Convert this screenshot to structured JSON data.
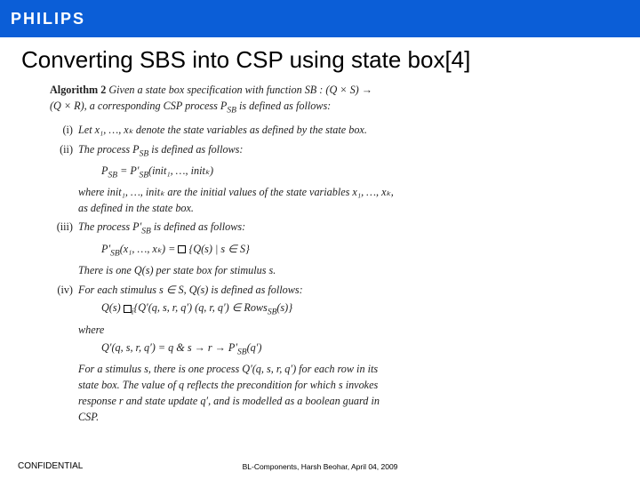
{
  "header": {
    "logo": "PHILIPS"
  },
  "title": "Converting SBS into CSP using state box[4]",
  "algo": {
    "label": "Algorithm 2",
    "intro1": "Given a state box specification with function SB : (Q × S) →",
    "intro2": "(Q × R), a corresponding CSP process P",
    "intro2_sub": "SB",
    "intro2_tail": " is defined as follows:",
    "items": [
      {
        "num": "(i)",
        "body": "Let x₁, …, xₖ denote the state variables as defined by the state box."
      },
      {
        "num": "(ii)",
        "body_a": "The process P",
        "body_a_sub": "SB",
        "body_a_tail": " is defined as follows:",
        "eq_a": "P",
        "eq_a_sub": "SB",
        "eq_a_mid": " = P′",
        "eq_a_sub2": "SB",
        "eq_a_tail": "(init₁, …, initₖ)",
        "body_b": "where init₁, …, initₖ are the initial values of the state variables x₁, …, xₖ,",
        "body_c": "as defined in the state box."
      },
      {
        "num": "(iii)",
        "body_a": "The process P′",
        "body_a_sub": "SB",
        "body_a_tail": " is defined as follows:",
        "eq_left": "P′",
        "eq_left_sub": "SB",
        "eq_left_tail": "(x₁, …, xₖ) = ",
        "eq_right": "{Q(s)  |  s ∈ S}",
        "body_b": "There is one Q(s) per state box for stimulus s."
      },
      {
        "num": "(iv)",
        "body_a": "For each stimulus s ∈ S, Q(s) is defined as follows:",
        "eq_left": "Q(s)  ",
        "eq_mid_sub": "i",
        "eq_mid": "{Q′(q, s, r, q′)     (q, r, q′) ∈ Rows",
        "eq_mid_sub2": "SB",
        "eq_mid_tail": "(s)}",
        "where": "where",
        "eq2": "Q′(q, s, r, q′) = q & s → r → P′",
        "eq2_sub": "SB",
        "eq2_tail": "(q′)",
        "tail1": "For a stimulus s, there is one process Q′(q, s, r, q′) for each row in its",
        "tail2": "state box. The value of q reflects the precondition for which s invokes",
        "tail3": "response r and state update q′, and is modelled as a boolean guard in",
        "tail4": "CSP."
      }
    ]
  },
  "footer": {
    "confidential": "CONFIDENTIAL",
    "meta": "BL-Components, Harsh Beohar, April 04, 2009"
  }
}
